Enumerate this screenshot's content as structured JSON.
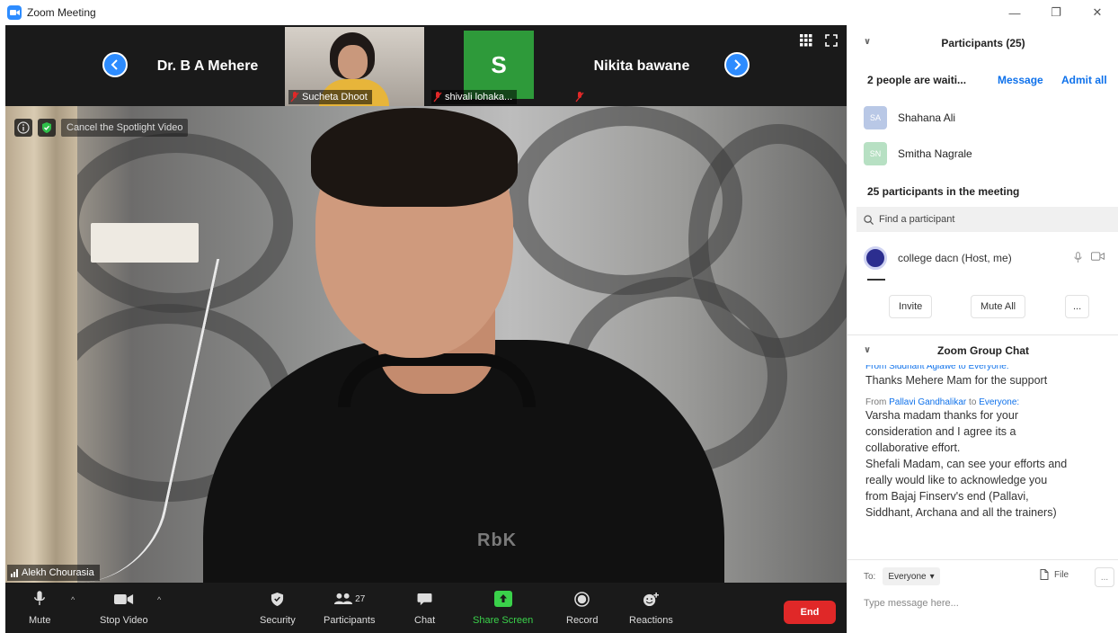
{
  "window": {
    "title": "Zoom Meeting",
    "controls": [
      "—",
      "❐",
      "✕"
    ]
  },
  "strip": {
    "tiles": [
      {
        "name": "Dr. B A Mehere",
        "label": ""
      },
      {
        "name": "",
        "label": "Sucheta Dhoot"
      },
      {
        "name": "S",
        "label": "shivali lohaka..."
      },
      {
        "name": "Nikita bawane",
        "label": ""
      }
    ]
  },
  "spotlight": {
    "button": "Cancel the Spotlight Video",
    "speaker_name": "Alekh Chourasia",
    "shirt_logo": "RbK"
  },
  "toolbar": {
    "mute": "Mute",
    "stop_video": "Stop Video",
    "security": "Security",
    "participants": "Participants",
    "participants_count": "27",
    "chat": "Chat",
    "share_screen": "Share Screen",
    "record": "Record",
    "reactions": "Reactions",
    "end": "End"
  },
  "participants_panel": {
    "title": "Participants (25)",
    "waiting_text": "2 people are waiti...",
    "message_link": "Message",
    "admit_all_link": "Admit all",
    "waiting": [
      {
        "initials": "SA",
        "name": "Shahana Ali",
        "color": "#b9c8e6"
      },
      {
        "initials": "SN",
        "name": "Smitha Nagrale",
        "color": "#b7e0c3"
      }
    ],
    "in_meeting": "25 participants in the meeting",
    "search_placeholder": "Find a participant",
    "host": "college dacn (Host, me)",
    "invite": "Invite",
    "mute_all": "Mute All",
    "more": "..."
  },
  "chat": {
    "title": "Zoom Group Chat",
    "cut_header": "From Siddhant Aglawe to Everyone:",
    "messages": [
      {
        "text": "Thanks Mehere Mam for the support"
      }
    ],
    "second": {
      "from_prefix": "From ",
      "from_name": "Pallavi Gandhalikar",
      "to_word": " to ",
      "to_name": "Everyone:",
      "lines": [
        "Varsha madam thanks for your",
        "consideration and I agree its a",
        "collaborative effort.",
        "Shefali Madam, can see your efforts and",
        "really would like to acknowledge you",
        "from Bajaj Finserv's end (Pallavi,",
        "Siddhant, Archana and all the trainers)"
      ]
    },
    "to_label": "To:",
    "to_value": "Everyone",
    "file_label": "File",
    "more": "...",
    "input_placeholder": "Type message here..."
  },
  "colors": {
    "accent": "#0e71eb",
    "end_red": "#e02828",
    "share_green": "#3ad14a",
    "tile_green": "#2e9a3a"
  }
}
